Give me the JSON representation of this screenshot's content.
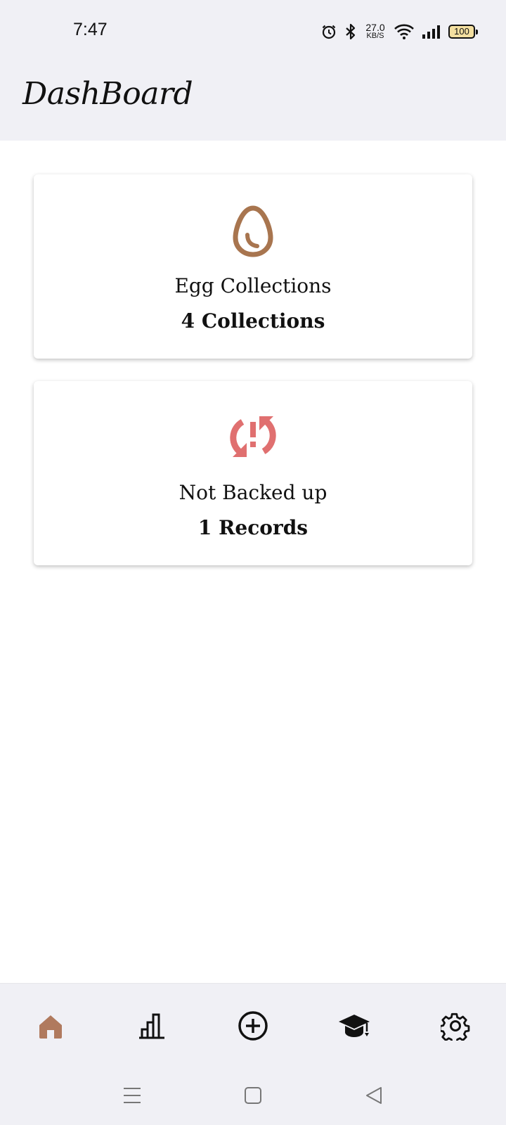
{
  "status_bar": {
    "time": "7:47",
    "net_speed_value": "27.0",
    "net_speed_unit": "KB/S",
    "battery": "100",
    "icons": [
      "alarm-icon",
      "bluetooth-icon",
      "wifi-icon",
      "signal-icon",
      "battery-icon"
    ]
  },
  "header": {
    "title": "DashBoard"
  },
  "cards": [
    {
      "icon": "egg-icon",
      "title": "Egg Collections",
      "value": "4 Collections",
      "icon_color": "#a8754f"
    },
    {
      "icon": "sync-alert-icon",
      "title": "Not Backed up",
      "value": "1 Records",
      "icon_color": "#e07070"
    }
  ],
  "bottom_nav": {
    "items": [
      "home-icon",
      "bar-chart-icon",
      "add-circle-icon",
      "graduation-cap-icon",
      "settings-gear-icon"
    ],
    "active": "home-icon",
    "active_color": "#b07a5e"
  },
  "system_nav": [
    "menu-icon",
    "home-square-icon",
    "back-icon"
  ],
  "colors": {
    "background": "#ffffff",
    "bars": "#f0f0f5"
  }
}
